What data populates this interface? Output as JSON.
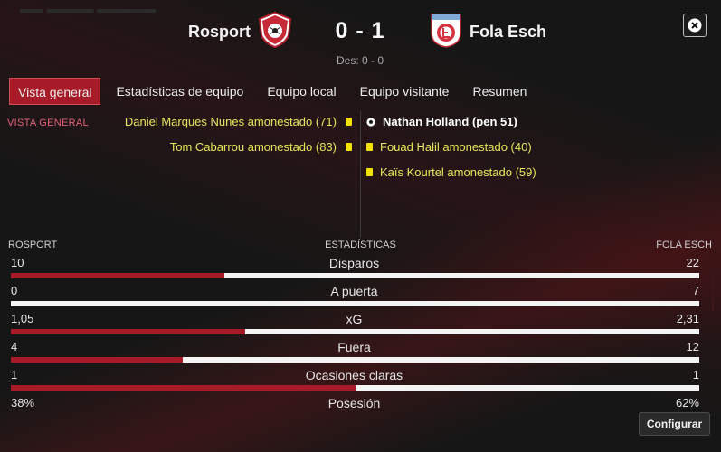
{
  "match": {
    "home_team": "Rosport",
    "away_team": "Fola Esch",
    "score": "0 - 1",
    "halftime": "Des: 0 - 0",
    "home_crest_icon": "rosport-crest-icon",
    "away_crest_icon": "fola-esch-crest-icon"
  },
  "tabs": [
    {
      "label": "Vista general",
      "active": true
    },
    {
      "label": "Estadísticas de equipo"
    },
    {
      "label": "Equipo local"
    },
    {
      "label": "Equipo visitante"
    },
    {
      "label": "Resumen"
    }
  ],
  "events": {
    "section_label": "VISTA GENERAL",
    "home": [
      {
        "text": "Daniel Marques Nunes amonestado (71)",
        "icon": "yellow-card-icon"
      },
      {
        "text": "Tom Cabarrou amonestado (83)",
        "icon": "yellow-card-icon"
      }
    ],
    "away": [
      {
        "text": "Nathan Holland (pen 51)",
        "icon": "ball-icon"
      },
      {
        "text": "Fouad Halil amonestado (40)",
        "icon": "yellow-card-icon"
      },
      {
        "text": "Kaïs Kourtel amonestado (59)",
        "icon": "yellow-card-icon"
      }
    ]
  },
  "stats": {
    "home_label": "ROSPORT",
    "center_label": "ESTADÍSTICAS",
    "away_label": "FOLA ESCH",
    "rows": [
      {
        "name": "Disparos",
        "home": "10",
        "away": "22",
        "home_share": 0.31
      },
      {
        "name": "A puerta",
        "home": "0",
        "away": "7",
        "home_share": 0.0
      },
      {
        "name": "xG",
        "home": "1,05",
        "away": "2,31",
        "home_share": 0.34
      },
      {
        "name": "Fuera",
        "home": "4",
        "away": "12",
        "home_share": 0.25
      },
      {
        "name": "Ocasiones claras",
        "home": "1",
        "away": "1",
        "home_share": 0.5
      },
      {
        "name": "Posesión",
        "home": "38%",
        "away": "62%",
        "home_share": 0.38
      }
    ]
  },
  "buttons": {
    "configure": "Configurar"
  },
  "colors": {
    "accent": "#a61b27",
    "yellow_card": "#f2e200",
    "event_text": "#e6e65c"
  }
}
